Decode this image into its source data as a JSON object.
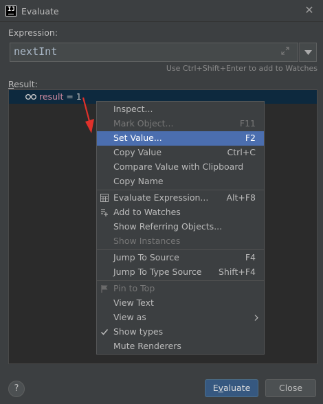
{
  "window": {
    "title": "Evaluate"
  },
  "expression": {
    "label": "Expression:",
    "value": "nextInt",
    "hint": "Use Ctrl+Shift+Enter to add to Watches"
  },
  "result": {
    "label_first": "R",
    "label_rest": "esult:",
    "name": "result",
    "equals": " = 1"
  },
  "menu": {
    "items": [
      {
        "label": "Inspect...",
        "shortcut": ""
      },
      {
        "label": "Mark Object...",
        "shortcut": "F11"
      },
      {
        "label": "Set Value...",
        "shortcut": "F2"
      },
      {
        "label": "Copy Value",
        "shortcut": "Ctrl+C"
      },
      {
        "label": "Compare Value with Clipboard",
        "shortcut": ""
      },
      {
        "label": "Copy Name",
        "shortcut": ""
      },
      {
        "label": "Evaluate Expression...",
        "shortcut": "Alt+F8"
      },
      {
        "label": "Add to Watches",
        "shortcut": ""
      },
      {
        "label": "Show Referring Objects...",
        "shortcut": ""
      },
      {
        "label": "Show Instances",
        "shortcut": ""
      },
      {
        "label": "Jump To Source",
        "shortcut": "F4"
      },
      {
        "label": "Jump To Type Source",
        "shortcut": "Shift+F4"
      },
      {
        "label": "Pin to Top",
        "shortcut": ""
      },
      {
        "label": "View Text",
        "shortcut": ""
      },
      {
        "label": "View as",
        "shortcut": ""
      },
      {
        "label": "Show types",
        "shortcut": ""
      },
      {
        "label": "Mute Renderers",
        "shortcut": ""
      }
    ],
    "selected_index": 2
  },
  "footer": {
    "help": "?",
    "evaluate_first": "E",
    "evaluate_under": "v",
    "evaluate_rest": "aluate",
    "close": "Close"
  },
  "colors": {
    "background": "#3c3f41",
    "selection": "#4b6eaf",
    "primary_button": "#365880",
    "annotation_arrow": "#e0312b"
  }
}
